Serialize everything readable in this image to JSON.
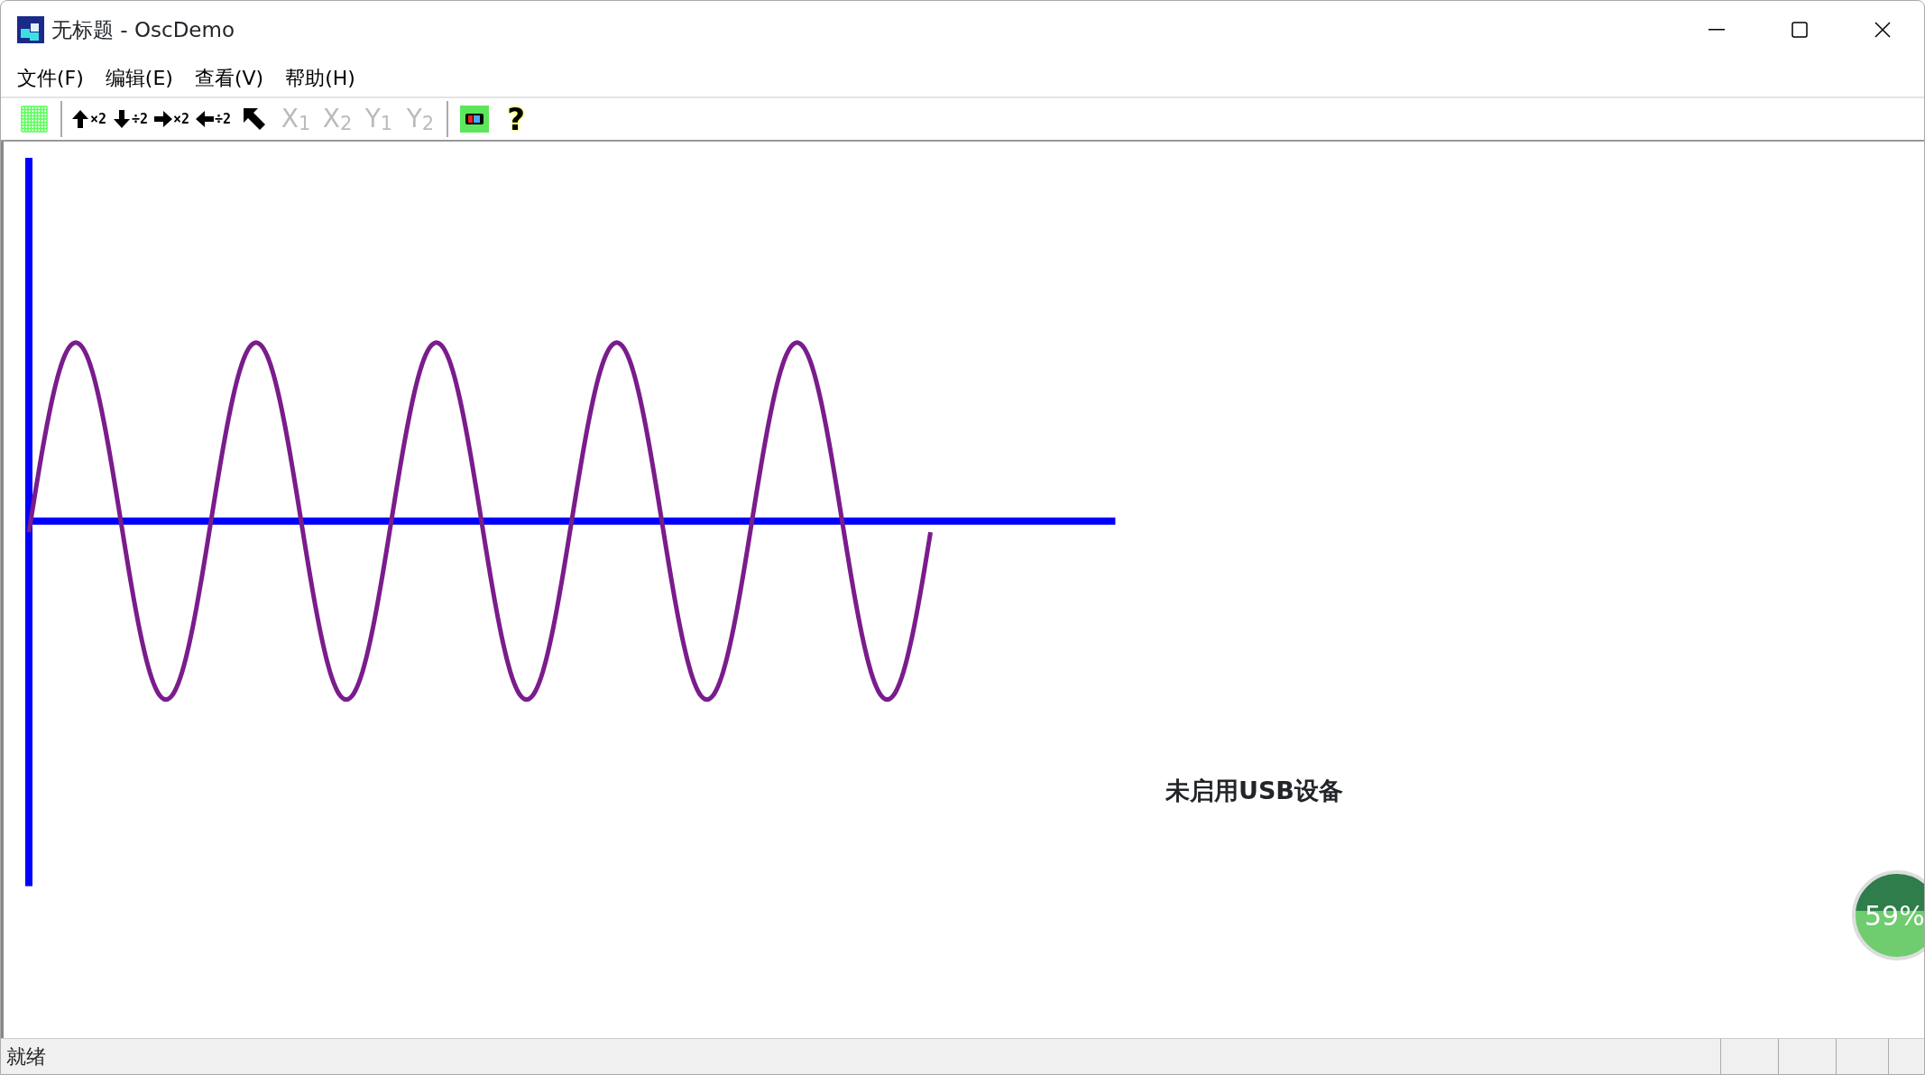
{
  "window": {
    "title": "无标题 - OscDemo"
  },
  "menu": [
    "文件(F)",
    "编辑(E)",
    "查看(V)",
    "帮助(H)"
  ],
  "toolbar": [
    {
      "kind": "grid"
    },
    {
      "kind": "separator"
    },
    {
      "kind": "arrow-up",
      "label": "×2"
    },
    {
      "kind": "arrow-down",
      "label": "÷2"
    },
    {
      "kind": "arrow-right",
      "label": "×2"
    },
    {
      "kind": "arrow-left",
      "label": "÷2"
    },
    {
      "kind": "pointer"
    },
    {
      "kind": "text",
      "label": "X$_{1}$",
      "disabled": true
    },
    {
      "kind": "text",
      "label": "X$_{2}$",
      "disabled": true
    },
    {
      "kind": "text",
      "label": "Y$_{1}$",
      "disabled": true
    },
    {
      "kind": "text",
      "label": "Y$_{2}$",
      "disabled": true
    },
    {
      "kind": "separator"
    },
    {
      "kind": "usb"
    },
    {
      "kind": "glyph",
      "label": "?"
    }
  ],
  "canvas": {
    "message": "未启用USB设备"
  },
  "floating_widget": {
    "text": "59%"
  },
  "status_bar": {
    "text": "就绪"
  }
}
